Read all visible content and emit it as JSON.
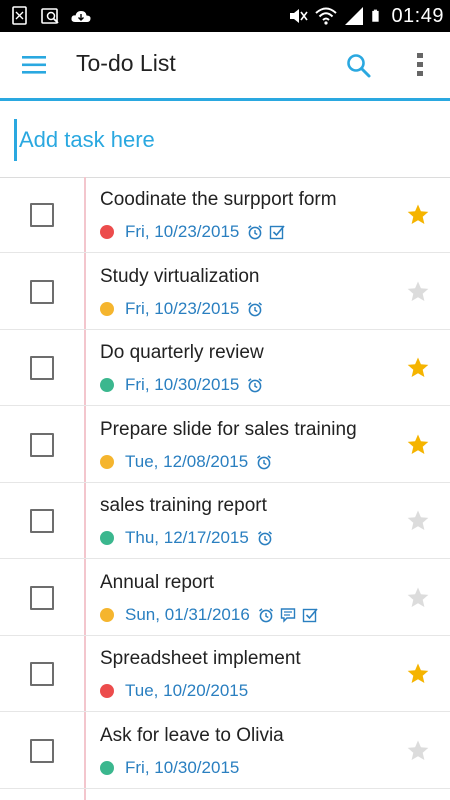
{
  "status_bar": {
    "time": "01:49",
    "left_icons": [
      "sim-card-icon",
      "image-search-icon",
      "cloud-download-icon"
    ],
    "right_icons": [
      "mute-icon",
      "wifi-icon",
      "signal-icon",
      "battery-icon"
    ]
  },
  "app_bar": {
    "title": "To-do List",
    "menu_icon": "hamburger-menu-icon",
    "search_icon": "search-icon",
    "more_icon": "more-vert-icon",
    "accent_color": "#2aa8e0"
  },
  "add_task": {
    "placeholder": "Add task here",
    "value": ""
  },
  "priority_colors": {
    "high": "#ec4c4c",
    "medium": "#f5b52e",
    "low": "#3bb78e"
  },
  "tasks": [
    {
      "title": "Coodinate the surpport form",
      "date": "Fri, 10/23/2015",
      "priority": "high",
      "reminder": true,
      "note": false,
      "subtasks": true,
      "starred": true
    },
    {
      "title": "Study virtualization",
      "date": "Fri, 10/23/2015",
      "priority": "medium",
      "reminder": true,
      "note": false,
      "subtasks": false,
      "starred": false
    },
    {
      "title": "Do quarterly review",
      "date": "Fri, 10/30/2015",
      "priority": "low",
      "reminder": true,
      "note": false,
      "subtasks": false,
      "starred": true
    },
    {
      "title": "Prepare slide for sales training",
      "date": "Tue, 12/08/2015",
      "priority": "medium",
      "reminder": true,
      "note": false,
      "subtasks": false,
      "starred": true
    },
    {
      "title": "sales training report",
      "date": "Thu, 12/17/2015",
      "priority": "low",
      "reminder": true,
      "note": false,
      "subtasks": false,
      "starred": false
    },
    {
      "title": "Annual report",
      "date": "Sun, 01/31/2016",
      "priority": "medium",
      "reminder": true,
      "note": true,
      "subtasks": true,
      "starred": false
    },
    {
      "title": "Spreadsheet implement",
      "date": "Tue, 10/20/2015",
      "priority": "high",
      "reminder": false,
      "note": false,
      "subtasks": false,
      "starred": true
    },
    {
      "title": "Ask for leave to Olivia",
      "date": "Fri, 10/30/2015",
      "priority": "low",
      "reminder": false,
      "note": false,
      "subtasks": false,
      "starred": false
    }
  ],
  "colors": {
    "star_on": "#f5b400",
    "star_off": "#dcdcdc",
    "date_text": "#2a7fc0",
    "meta_icon": "#2a7fc0"
  }
}
